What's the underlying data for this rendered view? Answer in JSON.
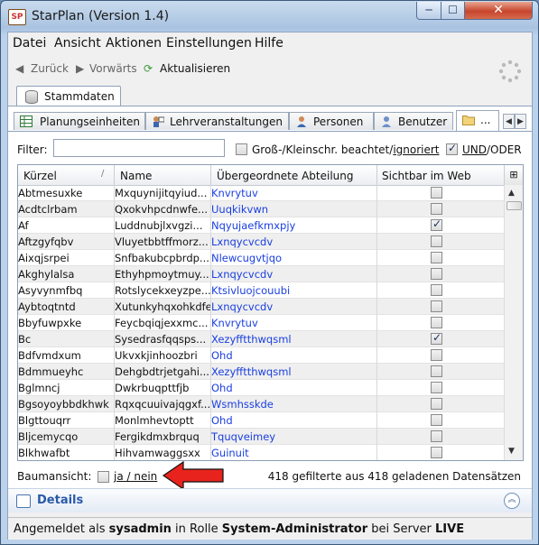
{
  "window": {
    "title": "StarPlan (Version 1.4)",
    "app_icon_text": "SP",
    "minimize": "─",
    "maximize": "☐",
    "close": "✕"
  },
  "menu": [
    "Datei",
    "Ansicht",
    "Aktionen",
    "Einstellungen",
    "Hilfe"
  ],
  "nav": {
    "back": "Zurück",
    "forward": "Vorwärts",
    "refresh": "Aktualisieren"
  },
  "outer_tab": "Stammdaten",
  "tabs": [
    "Planungseinheiten",
    "Lehrveranstaltungen",
    "Personen",
    "Benutzer",
    "..."
  ],
  "filter": {
    "label": "Filter:",
    "value": "",
    "case_label_prefix": "Groß-/Kleinschr. beachtet/",
    "case_label_underlined": "ignoriert",
    "case_checked": false,
    "and_checked": true,
    "and_label": "UND",
    "or_label": "/ODER"
  },
  "table": {
    "columns": [
      "Kürzel",
      "Name",
      "Übergeordnete Abteilung",
      "Sichtbar im Web"
    ],
    "rows": [
      {
        "kurz": "Abtmesuxke",
        "name": "Mxquynijitqyiud...",
        "abt": "Knvrytuv",
        "web": false
      },
      {
        "kurz": "Acdtclrbam",
        "name": "Qxokvhpcdnwfe...",
        "abt": "Uuqkikvwn",
        "web": false
      },
      {
        "kurz": "Af",
        "name": "Luddnubjlxvgzi...",
        "abt": "Nqyujaefkmxpjy",
        "web": true
      },
      {
        "kurz": "Aftzgyfqbv",
        "name": "Vluyetbbtffmorz...",
        "abt": "Lxnqycvcdv",
        "web": false
      },
      {
        "kurz": "Aixqjsrpei",
        "name": "Snfbakubcpbrdp...",
        "abt": "Nlewcugvtjqo",
        "web": false
      },
      {
        "kurz": "Akghylalsa",
        "name": "Ethyhpmoytmuy...",
        "abt": "Lxnqycvcdv",
        "web": false
      },
      {
        "kurz": "Asyvynmfbq",
        "name": "Rotslycekxeyzpe...",
        "abt": "Ktsivluojcouubi",
        "web": false
      },
      {
        "kurz": "Aybtoqtntd",
        "name": "Xutunkyhqxohkdfe",
        "abt": "Lxnqycvcdv",
        "web": false
      },
      {
        "kurz": "Bbyfuwpxke",
        "name": "Feycbqiqjexxmc...",
        "abt": "Knvrytuv",
        "web": false
      },
      {
        "kurz": "Bc",
        "name": "Sysedrasfqqsps...",
        "abt": "Xezyfftthwqsml",
        "web": true
      },
      {
        "kurz": "Bdfvmdxum",
        "name": "Ukvxkjinhoozbri",
        "abt": "Ohd",
        "web": false
      },
      {
        "kurz": "Bdmmueyhc",
        "name": "Dehgbdtrjetgahi...",
        "abt": "Xezyfftthwqsml",
        "web": false
      },
      {
        "kurz": "Bglmncj",
        "name": "Dwkrbuqpttfjb",
        "abt": "Ohd",
        "web": false
      },
      {
        "kurz": "Bgsoyoybbdkhwk",
        "name": "Rqxqcuuivajqgxf...",
        "abt": "Wsmhsskde",
        "web": false
      },
      {
        "kurz": "Blgttouqrr",
        "name": "Monlmhevtoptt",
        "abt": "Ohd",
        "web": false
      },
      {
        "kurz": "Bljcemycqo",
        "name": "Fergikdmxbrquq",
        "abt": "Tquqveimey",
        "web": false
      },
      {
        "kurz": "Blkhwafbt",
        "name": "Hihvamwaggsxx",
        "abt": "Guinuit",
        "web": false
      }
    ]
  },
  "tree": {
    "label": "Baumansicht:",
    "toggle": "ja / nein",
    "checked": false
  },
  "count_text": "418 gefilterte aus 418 geladenen Datensätzen",
  "details_label": "Details",
  "status": {
    "prefix": "Angemeldet als ",
    "user": "sysadmin",
    "mid": " in Rolle ",
    "role": "System-Administrator",
    "mid2": " bei Server ",
    "server": "LIVE"
  },
  "colors": {
    "accent_link": "#1a3fe0",
    "arrow": "#e8231d",
    "close_button": "#c7452c"
  }
}
